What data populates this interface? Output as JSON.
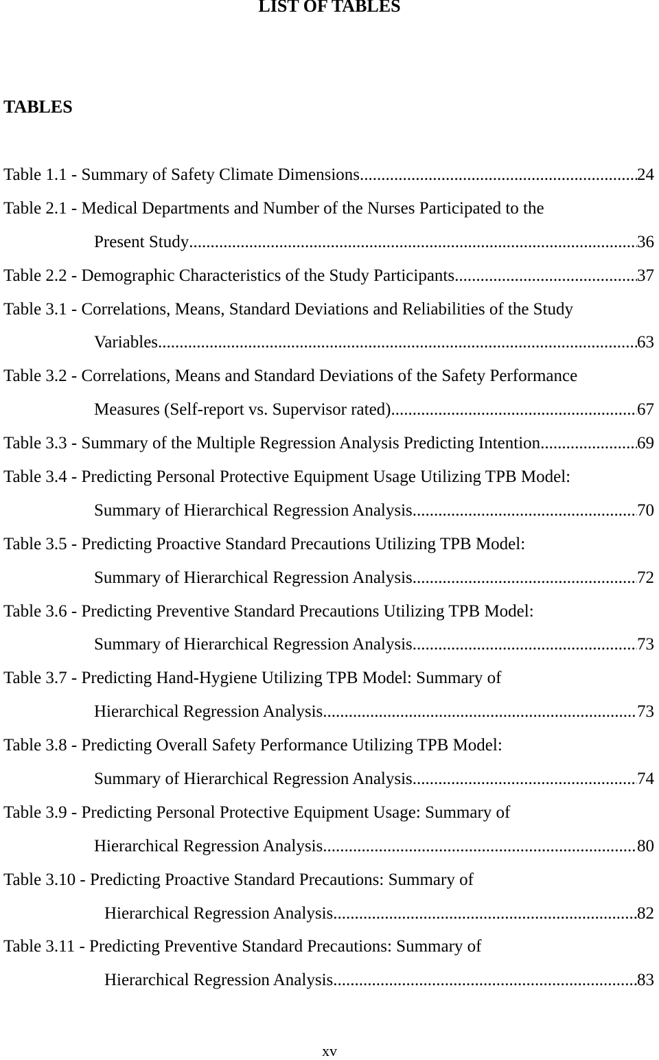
{
  "title": "LIST OF TABLES",
  "section": "TABLES",
  "entries": [
    {
      "lines": [
        "Table 1.1 - Summary of Safety Climate Dimensions"
      ],
      "page": "24",
      "indent": 0
    },
    {
      "lines": [
        "Table 2.1 - Medical Departments and Number of the Nurses Participated to the",
        "Present Study"
      ],
      "page": "36",
      "indent": 132
    },
    {
      "lines": [
        "Table 2.2 - Demographic Characteristics of the Study Participants"
      ],
      "page": "37",
      "indent": 0
    },
    {
      "lines": [
        "Table 3.1 - Correlations, Means, Standard Deviations and Reliabilities of the Study",
        "Variables"
      ],
      "page": "63",
      "indent": 132
    },
    {
      "lines": [
        "Table 3.2 - Correlations, Means and Standard Deviations of the Safety Performance",
        "Measures (Self-report vs. Supervisor rated)"
      ],
      "page": "67",
      "indent": 132
    },
    {
      "lines": [
        "Table 3.3 - Summary of the Multiple Regression Analysis Predicting Intention"
      ],
      "page": "69",
      "indent": 0
    },
    {
      "lines": [
        "Table 3.4 - Predicting Personal Protective Equipment Usage Utilizing TPB Model:",
        "Summary of Hierarchical Regression Analysis"
      ],
      "page": "70",
      "indent": 132
    },
    {
      "lines": [
        "Table 3.5 - Predicting Proactive Standard Precautions Utilizing TPB Model:",
        "Summary of Hierarchical Regression Analysis"
      ],
      "page": "72",
      "indent": 132
    },
    {
      "lines": [
        "Table 3.6 - Predicting Preventive Standard Precautions Utilizing TPB Model:",
        "Summary of Hierarchical Regression Analysis"
      ],
      "page": "73",
      "indent": 132
    },
    {
      "lines": [
        "Table 3.7 - Predicting Hand-Hygiene Utilizing TPB Model: Summary of",
        "Hierarchical Regression Analysis"
      ],
      "page": "73",
      "indent": 132
    },
    {
      "lines": [
        "Table 3.8 - Predicting Overall Safety Performance Utilizing TPB Model:",
        "Summary of Hierarchical Regression Analysis"
      ],
      "page": "74",
      "indent": 132
    },
    {
      "lines": [
        "Table 3.9 - Predicting Personal Protective Equipment Usage: Summary of",
        "Hierarchical Regression Analysis"
      ],
      "page": "80",
      "indent": 132
    },
    {
      "lines": [
        "Table 3.10 - Predicting Proactive Standard Precautions: Summary of",
        "Hierarchical Regression Analysis"
      ],
      "page": "82",
      "indent": 147
    },
    {
      "lines": [
        "Table 3.11 - Predicting Preventive Standard Precautions: Summary of",
        "Hierarchical Regression Analysis"
      ],
      "page": "83",
      "indent": 147
    }
  ],
  "page_number": "xv"
}
